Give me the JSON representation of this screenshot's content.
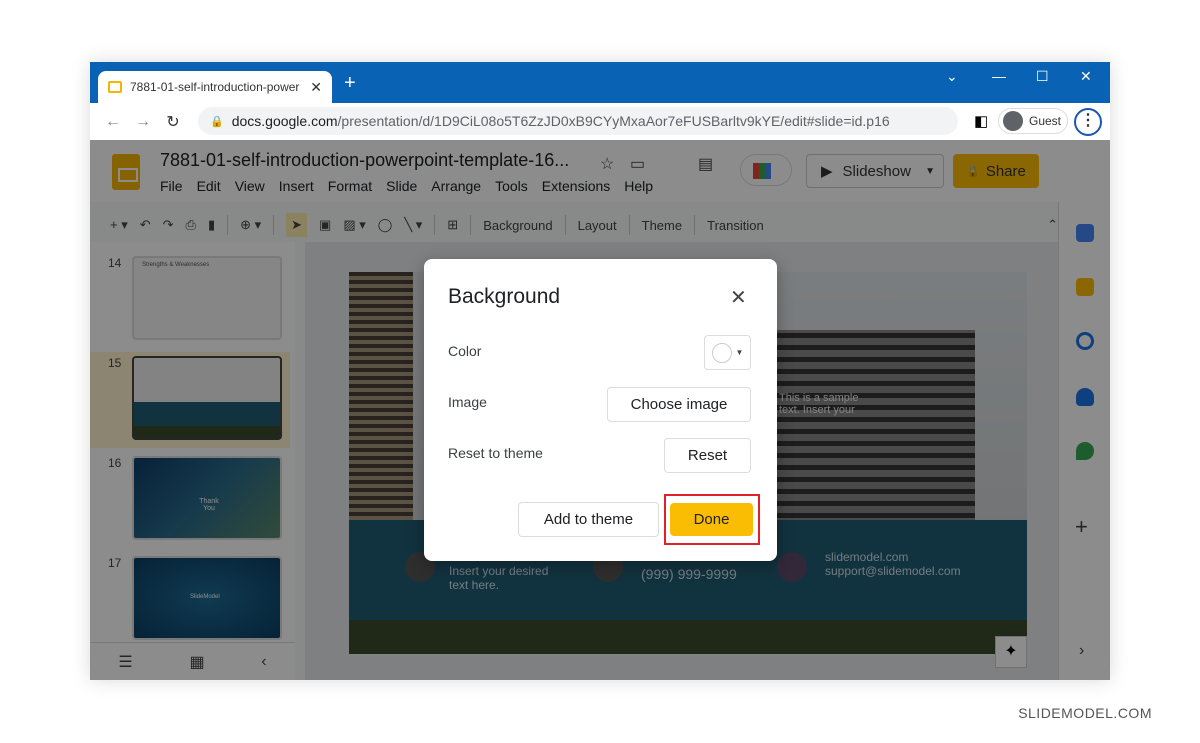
{
  "browser": {
    "tab_title": "7881-01-self-introduction-power",
    "url_domain": "docs.google.com",
    "url_path": "/presentation/d/1D9CiL08o5T6ZzJD0xB9CYyMxaAor7eFUSBarltv9kYE/edit#slide=id.p16",
    "profile_label": "Guest",
    "accent_color": "#0a62b5"
  },
  "app": {
    "doc_title": "7881-01-self-introduction-powerpoint-template-16...",
    "menu": [
      "File",
      "Edit",
      "View",
      "Insert",
      "Format",
      "Slide",
      "Arrange",
      "Tools",
      "Extensions",
      "Help"
    ],
    "slideshow_label": "Slideshow",
    "share_label": "Share",
    "toolbar": {
      "background": "Background",
      "layout": "Layout",
      "theme": "Theme",
      "transition": "Transition"
    },
    "slides": [
      {
        "num": "14",
        "caption": "Strengths & Weaknesses"
      },
      {
        "num": "15",
        "caption": ""
      },
      {
        "num": "16",
        "caption": "Thank You"
      },
      {
        "num": "17",
        "caption": "SlideModel"
      }
    ],
    "slide_content": {
      "sample_text": "This is a sample text. Insert your",
      "address": "Insert your desired text here.",
      "phone": "(999) 999-9999",
      "web": "slidemodel.com",
      "email": "support@slidemodel.com"
    }
  },
  "dialog": {
    "title": "Background",
    "color_label": "Color",
    "image_label": "Image",
    "choose_image": "Choose image",
    "reset_label": "Reset to theme",
    "reset_button": "Reset",
    "add_to_theme": "Add to theme",
    "done": "Done",
    "done_color": "#fbbc04",
    "highlight_color": "#e0202a"
  },
  "watermark": "SLIDEMODEL.COM"
}
